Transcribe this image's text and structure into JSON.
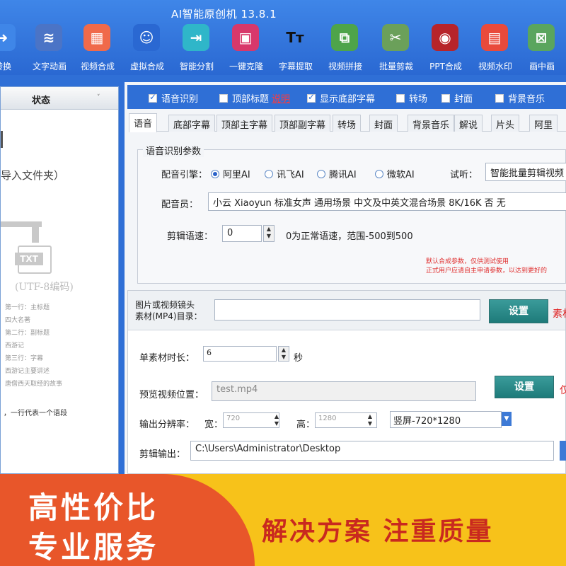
{
  "app": {
    "title": "AI智能原创机 13.8.1"
  },
  "toolbar": [
    {
      "label": "转换",
      "icon": "arrow-icon",
      "color": "#3f86e8"
    },
    {
      "label": "文字动画",
      "icon": "waveform-icon",
      "color": "#4b74c6"
    },
    {
      "label": "视频合成",
      "icon": "grid-icon",
      "color": "#f06a4a"
    },
    {
      "label": "虚拟合成",
      "icon": "avatar-icon",
      "color": "#2a68d2"
    },
    {
      "label": "智能分割",
      "icon": "split-icon",
      "color": "#2fb6c9"
    },
    {
      "label": "一键克隆",
      "icon": "clone-icon",
      "color": "#d8386b"
    },
    {
      "label": "字幕提取",
      "icon": "text-icon",
      "color": "#f2f2f2"
    },
    {
      "label": "视频拼接",
      "icon": "merge-icon",
      "color": "#4ea44a"
    },
    {
      "label": "批量剪裁",
      "icon": "scissors-icon",
      "color": "#6ba05a"
    },
    {
      "label": "PPT合成",
      "icon": "audio-icon",
      "color": "#b7242a"
    },
    {
      "label": "视频水印",
      "icon": "watermark-icon",
      "color": "#e94a3b"
    },
    {
      "label": "画中画",
      "icon": "pip-icon",
      "color": "#5aa55e"
    }
  ],
  "left_panel": {
    "header_status": "状态",
    "hint_folder": "导入文件夹）",
    "txt_label": "TXT",
    "encoding": "(UTF-8编码)",
    "lines": [
      "第一行：主标题",
      "四大名著",
      "第二行：副标题",
      "西游记",
      "第三行：字幕",
      "西游记主要讲述",
      "唐僧西天取经的故事"
    ],
    "footer_hint": "，一行代表一个语段"
  },
  "checkbar": [
    {
      "label": "语音识别",
      "checked": true
    },
    {
      "label": "顶部标题",
      "checked": false,
      "link": "说明"
    },
    {
      "label": "显示底部字幕",
      "checked": true
    },
    {
      "label": "转场",
      "checked": false
    },
    {
      "label": "封面",
      "checked": false
    },
    {
      "label": "背景音乐",
      "checked": false
    }
  ],
  "tabs": [
    "语音",
    "底部字幕",
    "顶部主字幕",
    "顶部副字幕",
    "转场",
    "封面",
    "背景音乐",
    "解说",
    "片头",
    "阿里"
  ],
  "speech": {
    "legend": "语音识别参数",
    "engine_label": "配音引擎：",
    "engines": [
      {
        "label": "阿里AI",
        "selected": true
      },
      {
        "label": "讯飞AI",
        "selected": false
      },
      {
        "label": "腾讯AI",
        "selected": false
      },
      {
        "label": "微软AI",
        "selected": false
      }
    ],
    "preview_label": "试听：",
    "preview_value": "智能批量剪辑视频",
    "voice_label": "配音员：",
    "voice_value": "小云 Xiaoyun 标准女声 通用场景 中文及中英文混合场景 8K/16K 否 无",
    "speed_label": "剪辑语速：",
    "speed_value": "0",
    "speed_hint": "0为正常语速，范围-500到500",
    "note_line1": "默认合成参数，仅供测试使用",
    "note_line2": "正式用户应请自主申请参数，以达到更好的"
  },
  "media": {
    "label": "图片或视频镜头\n素材(MP4)目录：",
    "path": "",
    "set_button": "设置",
    "red_hint": "素材"
  },
  "clip": {
    "duration_label": "单素材时长：",
    "duration_value": "6",
    "duration_unit": "秒",
    "preview_pos_label": "预览视频位置：",
    "preview_pos_value": "test.mp4",
    "preview_set_button": "设置",
    "preview_red": "仅",
    "resolution_label": "输出分辨率：",
    "width_label": "宽：",
    "width_value": "720",
    "height_label": "高：",
    "height_value": "1280",
    "preset": "竖屏-720*1280",
    "output_label": "剪辑输出：",
    "output_value": "C:\\Users\\Administrator\\Desktop"
  },
  "promo": {
    "line1": "高性价比",
    "line2": "专业服务",
    "right": "解决方案 注重质量"
  },
  "colors": {
    "accent": "#2f6fd6",
    "button_teal": "#1e7b7a",
    "promo_orange": "#e8562a",
    "promo_yellow": "#f7c21a",
    "warn_red": "#e03030"
  }
}
